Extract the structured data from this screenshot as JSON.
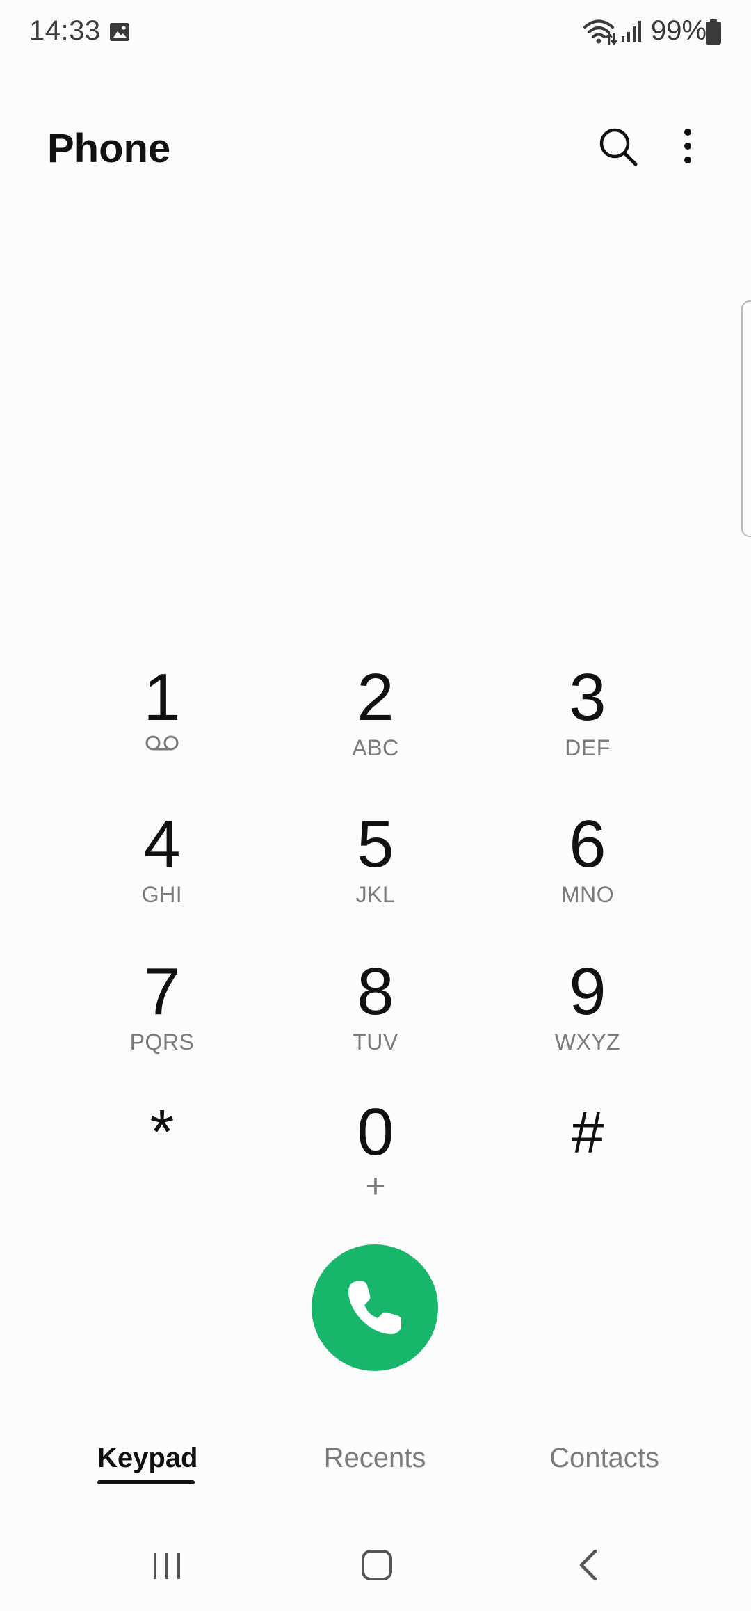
{
  "status_bar": {
    "time": "14:33",
    "battery_percent": "99%",
    "icons": [
      "gallery-icon",
      "wifi-icon",
      "signal-icon",
      "battery-icon"
    ]
  },
  "header": {
    "title": "Phone",
    "search_icon": "search-icon",
    "more_icon": "more-vert-icon"
  },
  "keypad": {
    "keys": [
      {
        "digit": "1",
        "letters": "",
        "sub_icon": "voicemail-icon"
      },
      {
        "digit": "2",
        "letters": "ABC"
      },
      {
        "digit": "3",
        "letters": "DEF"
      },
      {
        "digit": "4",
        "letters": "GHI"
      },
      {
        "digit": "5",
        "letters": "JKL"
      },
      {
        "digit": "6",
        "letters": "MNO"
      },
      {
        "digit": "7",
        "letters": "PQRS"
      },
      {
        "digit": "8",
        "letters": "TUV"
      },
      {
        "digit": "9",
        "letters": "WXYZ"
      },
      {
        "digit": "*",
        "letters": ""
      },
      {
        "digit": "0",
        "letters": "+"
      },
      {
        "digit": "#",
        "letters": ""
      }
    ]
  },
  "call": {
    "icon": "phone-icon",
    "color": "#18b66b"
  },
  "tabs": [
    {
      "label": "Keypad",
      "active": true
    },
    {
      "label": "Recents",
      "active": false
    },
    {
      "label": "Contacts",
      "active": false
    }
  ],
  "nav": {
    "icons": [
      "recent-apps-icon",
      "home-icon",
      "back-icon"
    ]
  }
}
